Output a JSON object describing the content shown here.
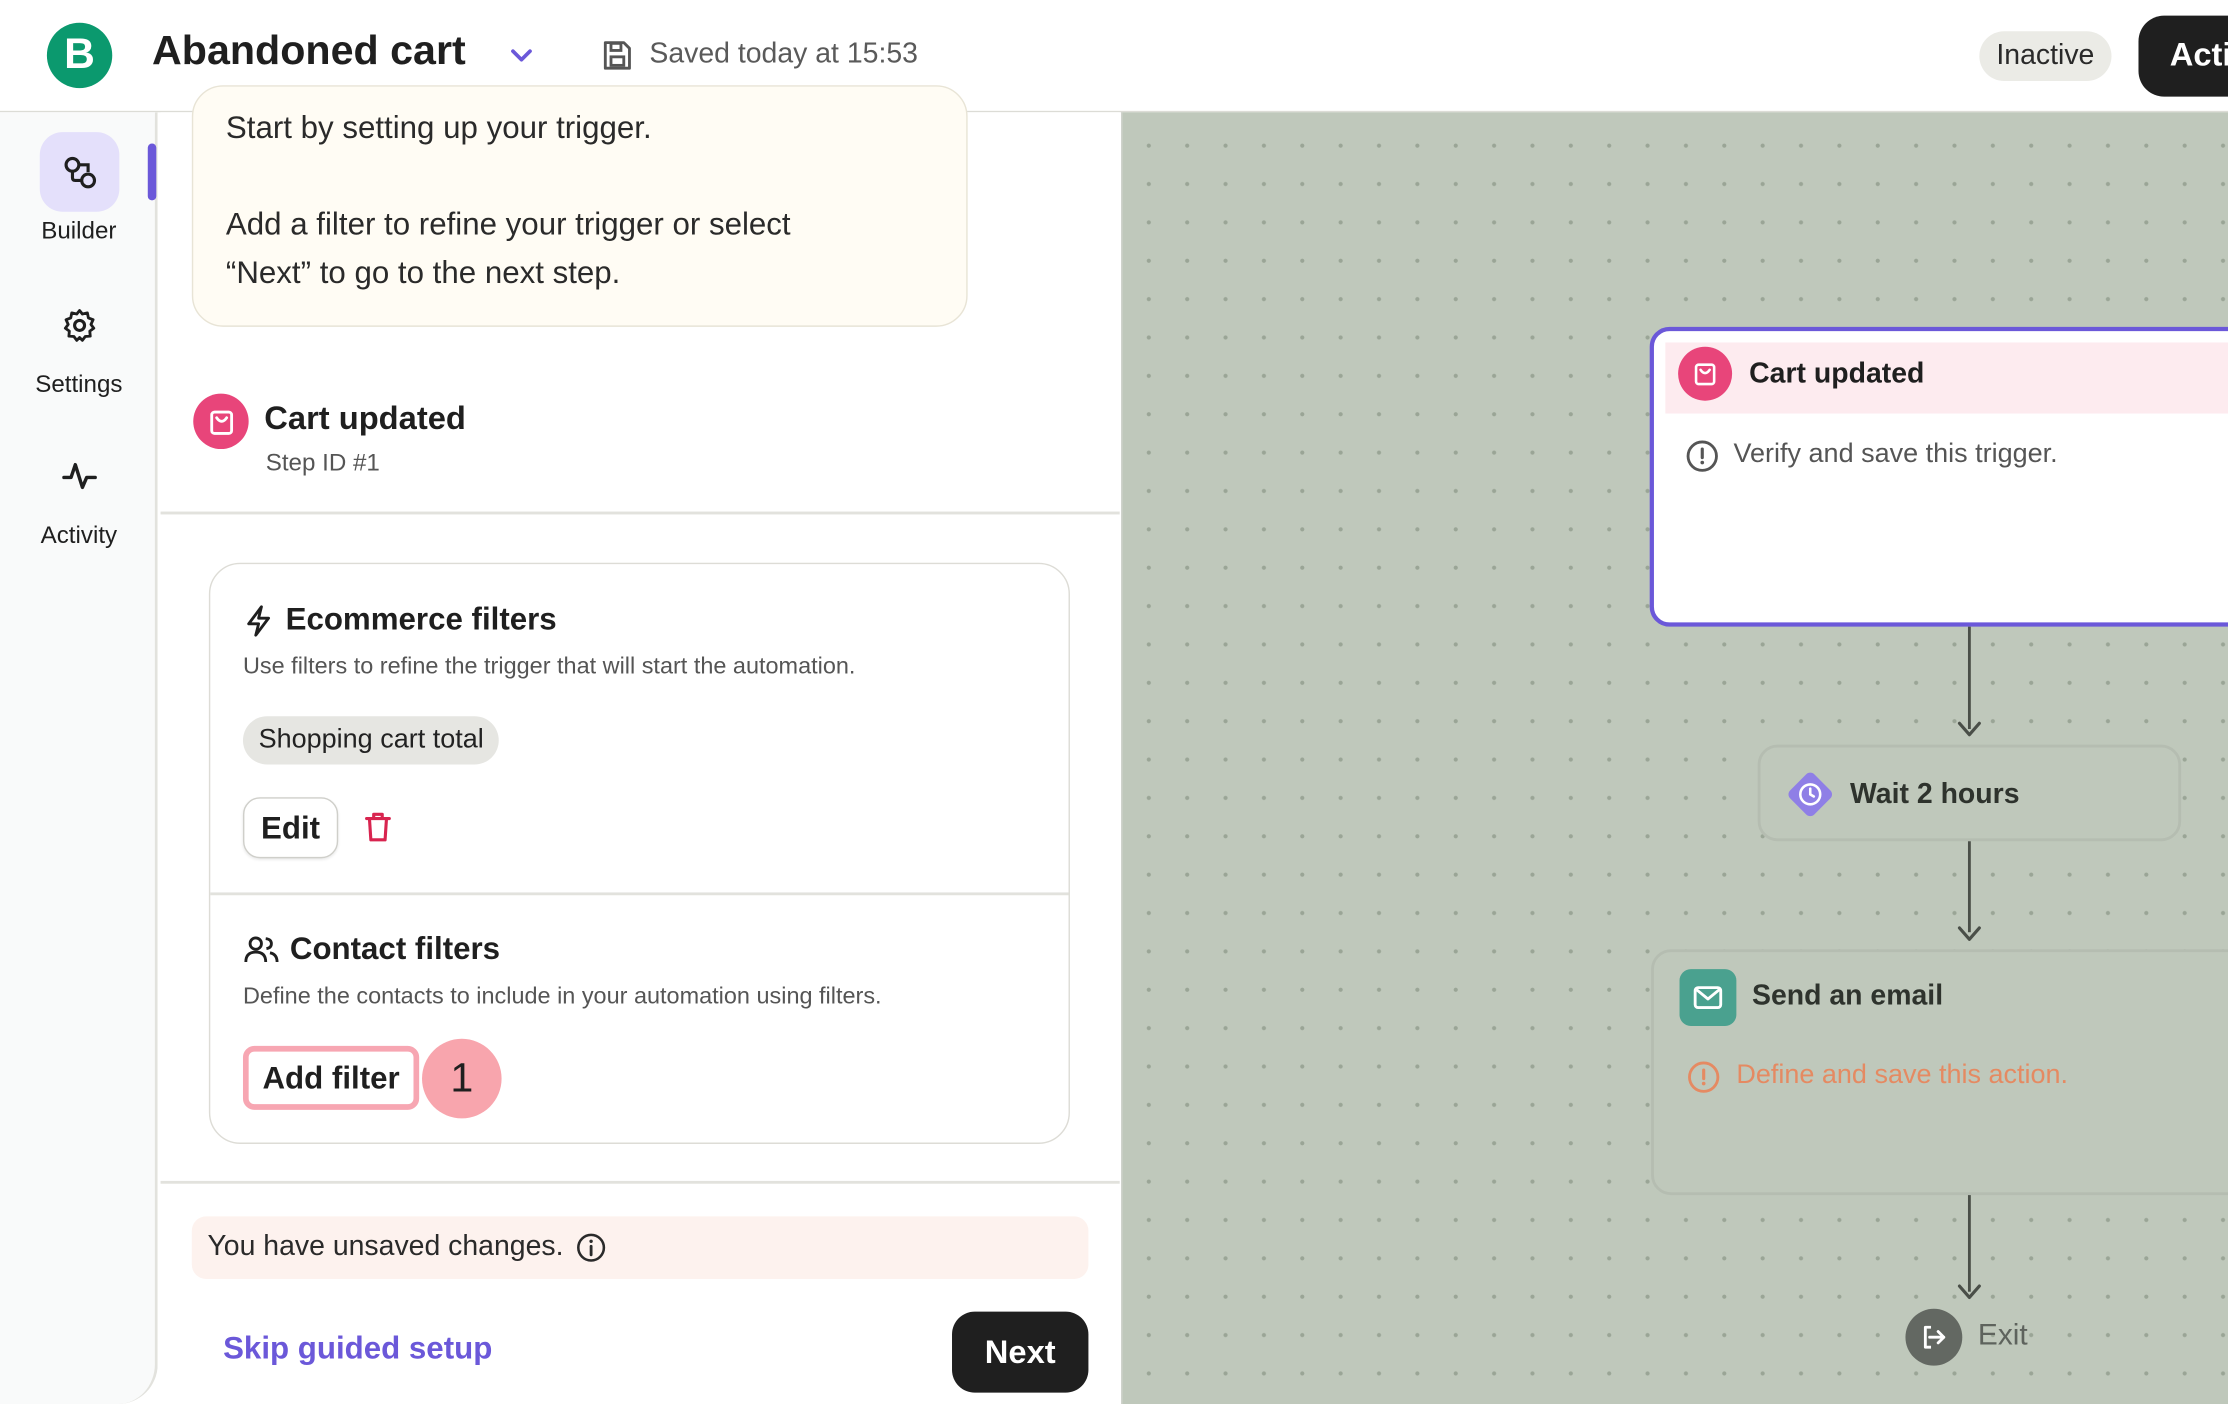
{
  "header": {
    "logo_letter": "B",
    "title": "Abandoned cart",
    "saved_status": "Saved today at 15:53",
    "status_badge": "Inactive",
    "activate_label": "Acti"
  },
  "rail": {
    "items": [
      {
        "label": "Builder",
        "icon": "builder-icon",
        "active": true
      },
      {
        "label": "Settings",
        "icon": "gear-icon",
        "active": false
      },
      {
        "label": "Activity",
        "icon": "activity-icon",
        "active": false
      }
    ]
  },
  "panel": {
    "info": {
      "line1": "Start by setting up your trigger.",
      "line2": "Add a filter to refine your trigger or select",
      "line3": "“Next” to go to the next step."
    },
    "trigger": {
      "title": "Cart updated",
      "step_id": "Step ID #1"
    },
    "ecommerce": {
      "title": "Ecommerce filters",
      "description": "Use filters to refine the trigger that will start the automation.",
      "chip": "Shopping cart total",
      "edit_label": "Edit"
    },
    "contact": {
      "title": "Contact filters",
      "description": "Define the contacts to include in your automation using filters.",
      "add_filter_label": "Add filter",
      "step_marker": "1"
    },
    "unsaved_text": "You have unsaved changes.",
    "skip_label": "Skip guided setup",
    "next_label": "Next"
  },
  "canvas": {
    "trigger_node": {
      "title": "Cart updated",
      "note": "Verify and save this trigger."
    },
    "wait_node": {
      "title": "Wait 2 hours"
    },
    "email_node": {
      "title": "Send an email",
      "warning": "Define and save this action."
    },
    "exit_label": "Exit"
  },
  "colors": {
    "accent": "#6b58d9",
    "brand_green": "#0b996e",
    "trigger_pink": "#e8457a",
    "warning_orange": "#e58a62",
    "canvas_bg": "#bfc8bb"
  }
}
